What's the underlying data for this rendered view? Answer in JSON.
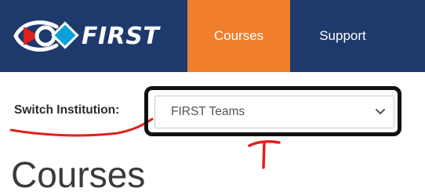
{
  "header": {
    "logo_text": "FIRST",
    "nav": {
      "courses_label": "Courses",
      "support_label": "Support"
    }
  },
  "institution": {
    "label": "Switch Institution:",
    "selected": "FIRST Teams"
  },
  "main": {
    "title": "Courses"
  },
  "colors": {
    "nav_background": "#1e3a6c",
    "active_tab": "#f07e2d",
    "annotation_red": "#e0201c",
    "highlight_border": "#111111"
  },
  "icons": {
    "logo": "first-logo-icon",
    "select_caret": "chevron-down-icon",
    "annotation": "arrow-up-icon"
  }
}
